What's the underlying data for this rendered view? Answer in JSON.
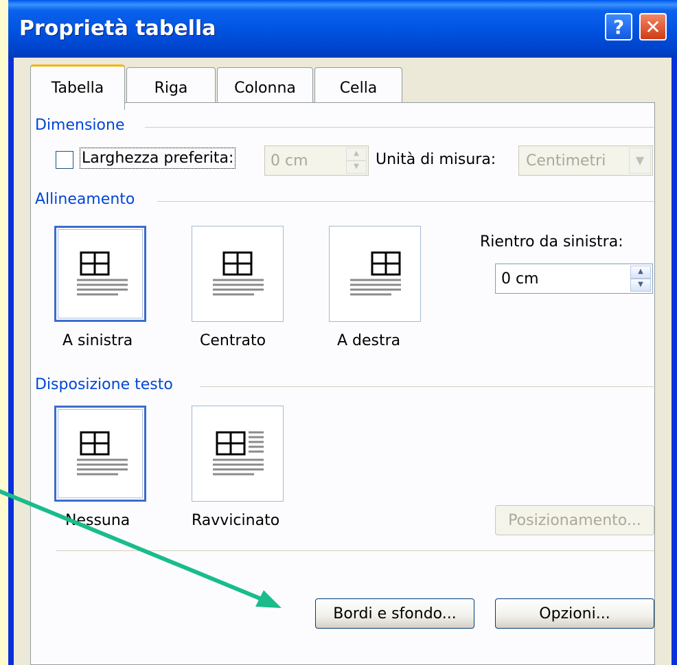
{
  "window": {
    "title": "Proprietà tabella"
  },
  "titlebar_buttons": {
    "help": "?",
    "close": "✕"
  },
  "tabs": [
    {
      "label": "Tabella",
      "active": true
    },
    {
      "label": "Riga",
      "active": false
    },
    {
      "label": "Colonna",
      "active": false
    },
    {
      "label": "Cella",
      "active": false
    }
  ],
  "dimensione": {
    "title": "Dimensione",
    "width_checkbox_label": "Larghezza preferita:",
    "width_checkbox_checked": false,
    "width_value": "0 cm",
    "unit_label": "Unità di misura:",
    "unit_value": "Centimetri"
  },
  "allineamento": {
    "title": "Allineamento",
    "options": [
      {
        "label": "A sinistra",
        "selected": true
      },
      {
        "label": "Centrato",
        "selected": false
      },
      {
        "label": "A destra",
        "selected": false
      }
    ],
    "indent_label": "Rientro da sinistra:",
    "indent_value": "0 cm"
  },
  "disposizione": {
    "title": "Disposizione testo",
    "options": [
      {
        "label": "Nessuna",
        "selected": true
      },
      {
        "label": "Ravvicinato",
        "selected": false
      }
    ],
    "position_button": "Posizionamento..."
  },
  "buttons": {
    "borders": "Bordi e sfondo...",
    "options": "Opzioni..."
  },
  "colors": {
    "backdrop": "#fffbd0",
    "title_bar": "#0052e0",
    "arrow": "#1abc8c"
  }
}
